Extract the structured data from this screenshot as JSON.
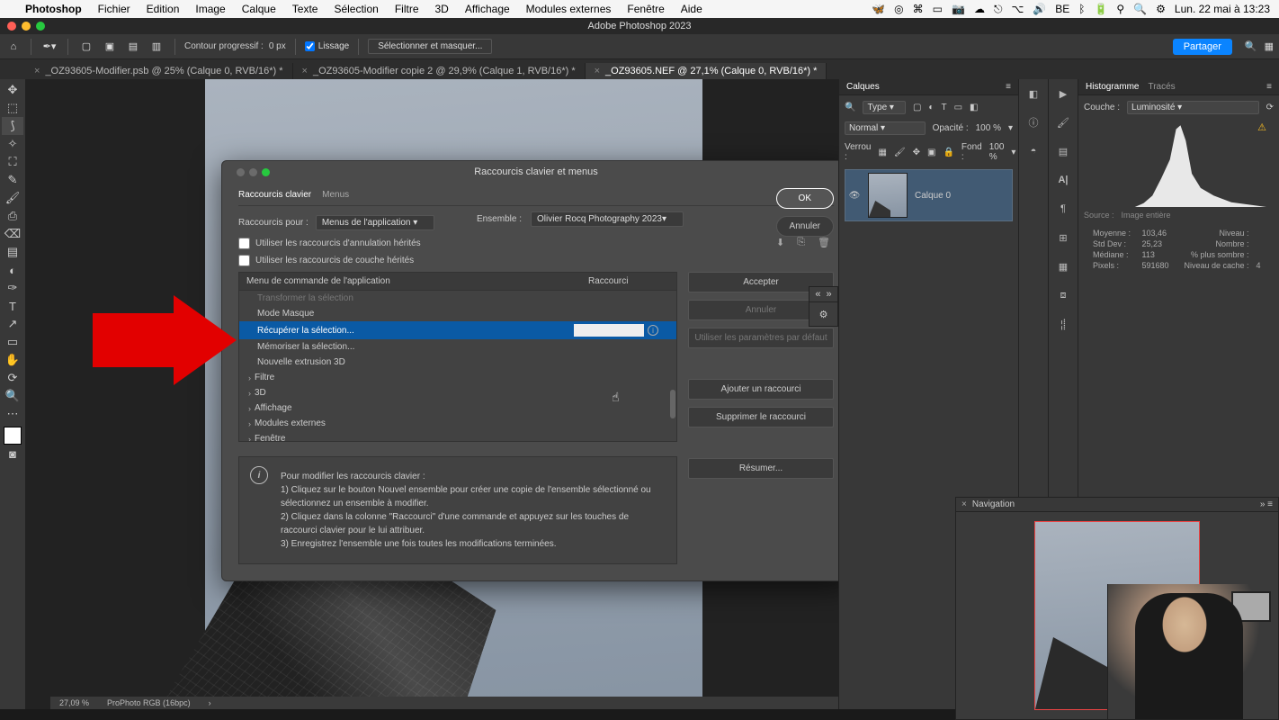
{
  "menubar": {
    "apple": "",
    "items": [
      "Photoshop",
      "Fichier",
      "Edition",
      "Image",
      "Calque",
      "Texte",
      "Sélection",
      "Filtre",
      "3D",
      "Affichage",
      "Modules externes",
      "Fenêtre",
      "Aide"
    ],
    "status_date": "Lun. 22 mai à 13:23"
  },
  "app_title": "Adobe Photoshop 2023",
  "options_bar": {
    "feather_label": "Contour progressif :",
    "feather_value": "0 px",
    "smooth_label": "Lissage",
    "select_mask": "Sélectionner et masquer...",
    "share": "Partager"
  },
  "doc_tabs": [
    {
      "label": "_OZ93605-Modifier.psb @ 25% (Calque 0, RVB/16*) *"
    },
    {
      "label": "_OZ93605-Modifier copie 2 @ 29,9% (Calque 1, RVB/16*) *"
    },
    {
      "label": "_OZ93605.NEF @ 27,1% (Calque 0, RVB/16*) *"
    }
  ],
  "dialog": {
    "title": "Raccourcis clavier et menus",
    "tab_shortcuts": "Raccourcis clavier",
    "tab_menus": "Menus",
    "shortcuts_for": "Raccourcis pour :",
    "shortcuts_for_value": "Menus de l'application",
    "legacy_undo": "Utiliser les raccourcis d'annulation hérités",
    "legacy_channel": "Utiliser les raccourcis de couche hérités",
    "set_label": "Ensemble :",
    "set_value": "Olivier Rocq Photography 2023",
    "col_command": "Menu de commande de l'application",
    "col_shortcut": "Raccourci",
    "items": {
      "i0": "Transformer la sélection",
      "i1": "Mode Masque",
      "i2": "Récupérer la sélection...",
      "i3": "Mémoriser la sélection...",
      "i4": "Nouvelle extrusion 3D",
      "i5": "Filtre",
      "i6": "3D",
      "i7": "Affichage",
      "i8": "Modules externes",
      "i9": "Fenêtre"
    },
    "btn_accept": "Accepter",
    "btn_undo": "Annuler",
    "btn_defaults": "Utiliser les paramètres par défaut",
    "btn_add": "Ajouter un raccourci",
    "btn_delete": "Supprimer le raccourci",
    "btn_summary": "Résumer...",
    "btn_ok": "OK",
    "btn_cancel": "Annuler",
    "info_title": "Pour modifier les raccourcis clavier :",
    "info_1": "1) Cliquez sur le bouton Nouvel ensemble pour créer une copie de l'ensemble sélectionné ou sélectionnez un ensemble à modifier.",
    "info_2": "2) Cliquez dans la colonne \"Raccourci\" d'une commande et appuyez sur les touches de raccourci clavier pour le lui attribuer.",
    "info_3": "3) Enregistrez l'ensemble une fois toutes les modifications terminées."
  },
  "layers_panel": {
    "title": "Calques",
    "kind": "Type",
    "blend": "Normal",
    "opacity_label": "Opacité :",
    "opacity_value": "100 %",
    "lock_label": "Verrou :",
    "fill_label": "Fond :",
    "fill_value": "100 %",
    "layer_name": "Calque 0"
  },
  "histogram_panel": {
    "title_hist": "Histogramme",
    "title_paths": "Tracés",
    "channel_label": "Couche :",
    "channel_value": "Luminosité",
    "source_label": "Source :",
    "source_value": "Image entière",
    "labels": {
      "avg": "Moyenne :",
      "std": "Std Dev :",
      "med": "Médiane :",
      "px": "Pixels :",
      "lvl": "Niveau :",
      "cnt": "Nombre :",
      "pct": "% plus sombre :",
      "cache": "Niveau de cache :"
    },
    "values": {
      "avg": "103,46",
      "std": "25,23",
      "med": "113",
      "px": "591680",
      "cache": "4"
    }
  },
  "nav_panel": {
    "title": "Navigation"
  },
  "statusbar": {
    "zoom": "27,09 %",
    "profile": "ProPhoto RGB (16bpc)"
  }
}
